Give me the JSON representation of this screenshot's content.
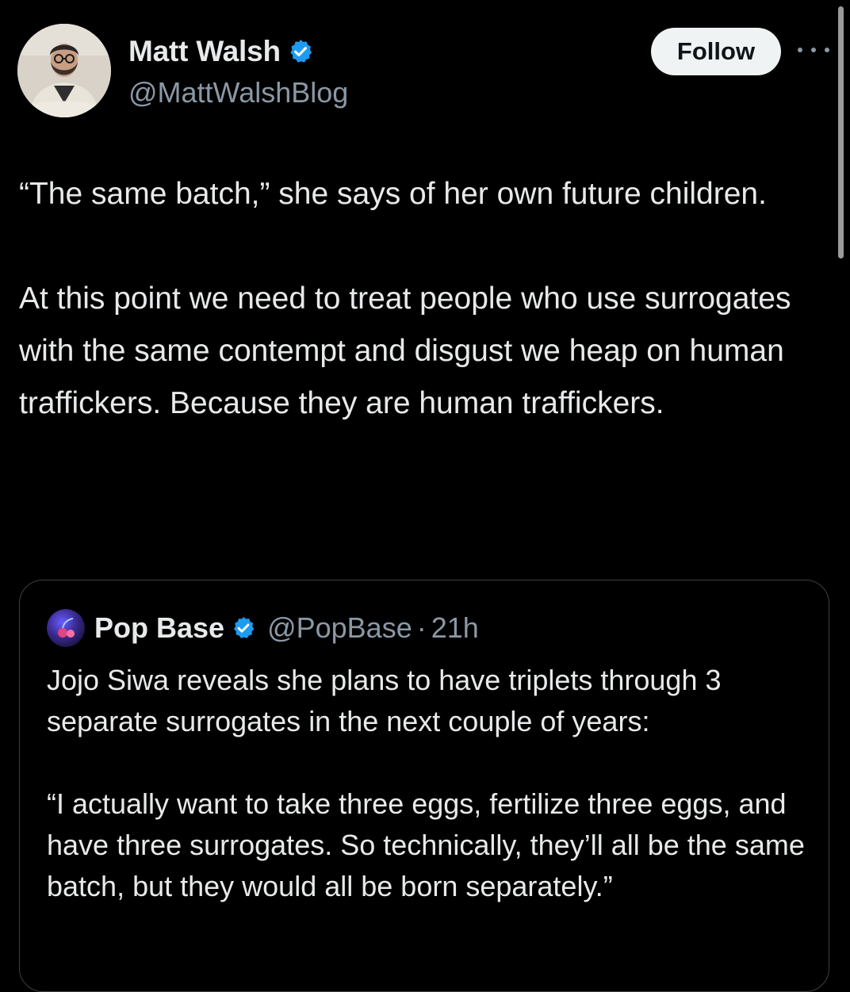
{
  "post": {
    "author": {
      "name": "Matt Walsh",
      "handle": "@MattWalshBlog",
      "verified": true
    },
    "follow_label": "Follow",
    "more_icon": "more-horizontal-icon",
    "text_paragraphs": [
      "“The same batch,” she says of her own future children.",
      "At this point we need to treat people who use surrogates with the same contempt and disgust we heap on human traffickers. Because they are human traffickers."
    ]
  },
  "quoted_post": {
    "author": {
      "name": "Pop Base",
      "handle": "@PopBase",
      "verified": true
    },
    "separator": "·",
    "time": "21h",
    "text_paragraphs": [
      "Jojo Siwa reveals she plans to have triplets through 3 separate surrogates in the next couple of years:",
      "“I actually want to take three eggs, fertilize three eggs, and have three surrogates. So technically, they’ll all be the same batch, but they would all be born separately.”"
    ]
  },
  "colors": {
    "background": "#000000",
    "text_primary": "#e7e9ea",
    "text_secondary": "#8b98a5",
    "verified_blue": "#1d9bf0",
    "follow_button_bg": "#eff3f4",
    "card_border": "#3c4043"
  }
}
